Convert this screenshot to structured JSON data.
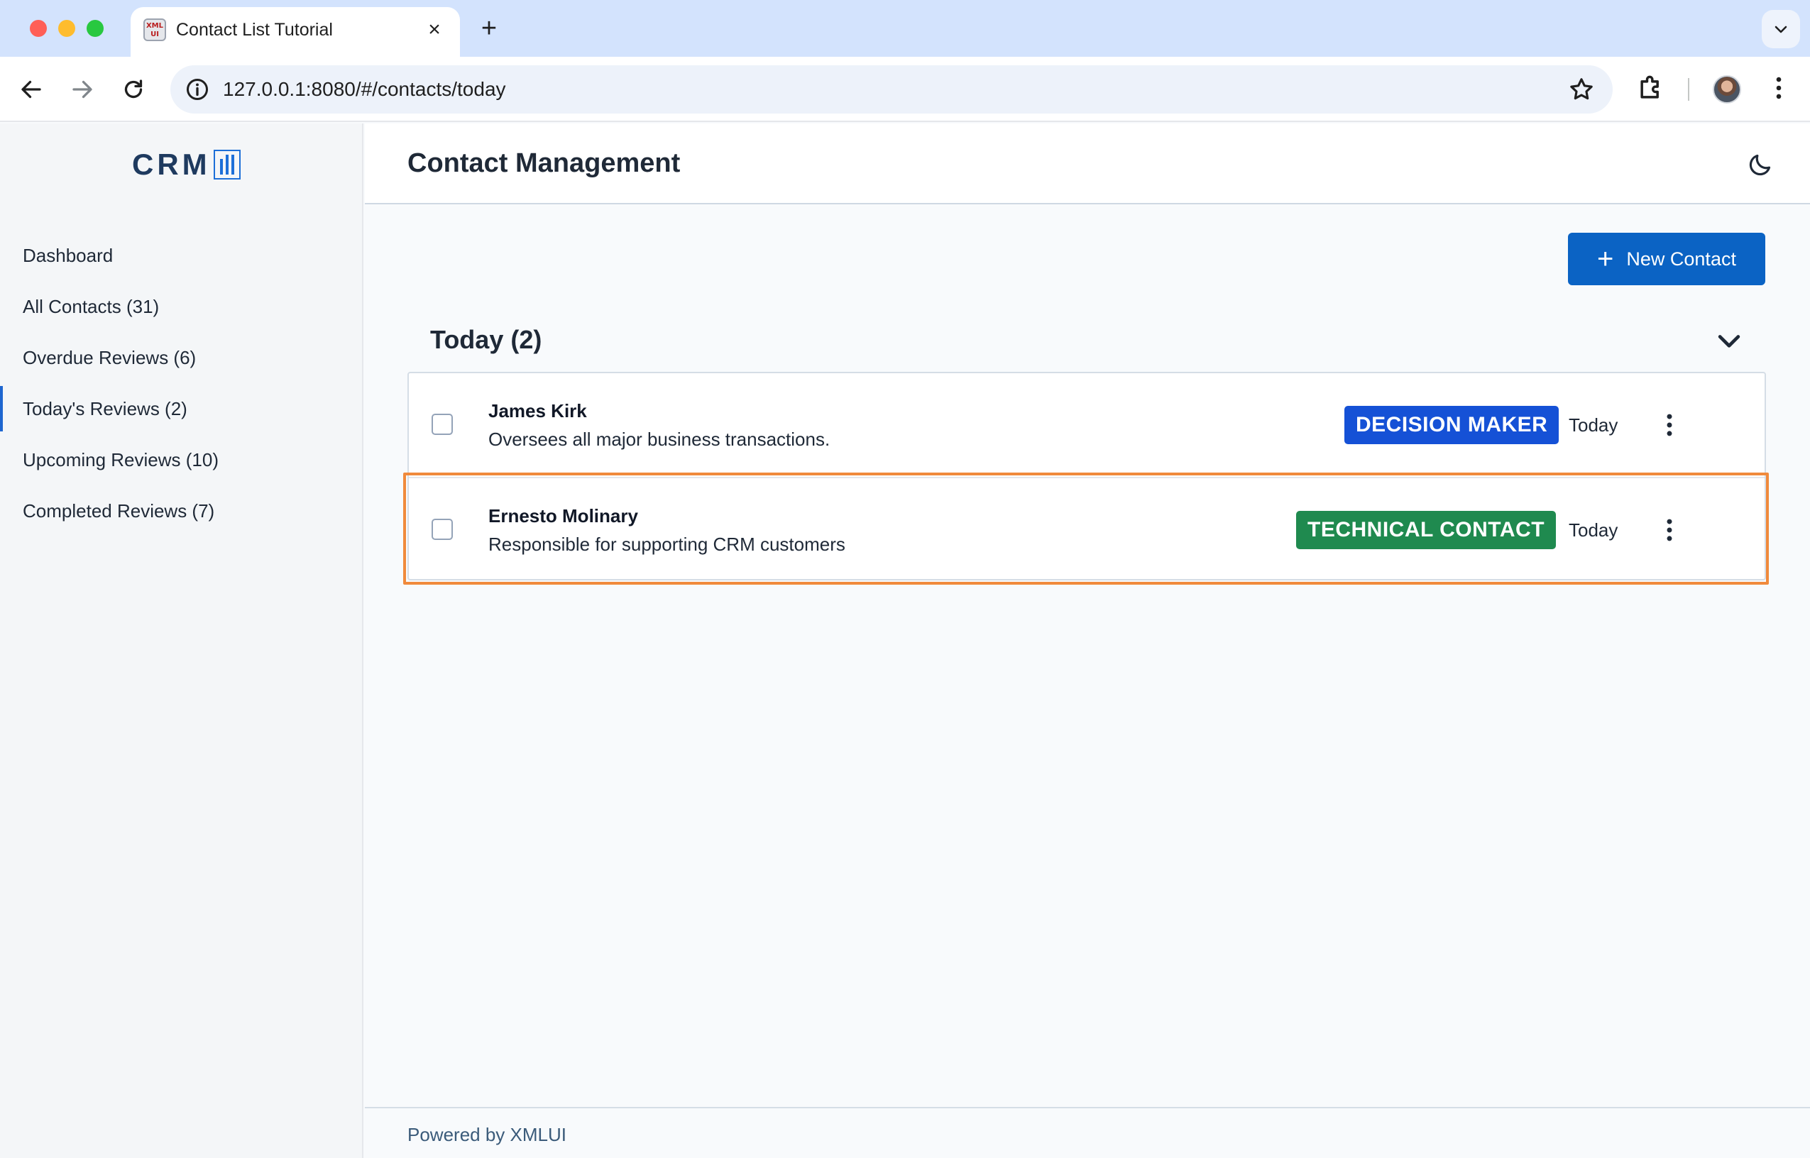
{
  "browser": {
    "tab_title": "Contact List Tutorial",
    "tab_favicon_text": "XML UI",
    "new_tab_symbol": "+",
    "url": "127.0.0.1:8080/#/contacts/today"
  },
  "app": {
    "logo_text": "CRM",
    "header_title": "Contact Management",
    "accent_color": "#0b63c4",
    "sidebar": {
      "items": [
        {
          "label": "Dashboard",
          "active": false
        },
        {
          "label": "All Contacts (31)",
          "active": false
        },
        {
          "label": "Overdue Reviews (6)",
          "active": false
        },
        {
          "label": "Today's Reviews (2)",
          "active": true
        },
        {
          "label": "Upcoming Reviews (10)",
          "active": false
        },
        {
          "label": "Completed Reviews (7)",
          "active": false
        }
      ]
    },
    "main": {
      "new_contact_label": "New Contact",
      "section_title": "Today (2)",
      "contacts": [
        {
          "name": "James Kirk",
          "description": "Oversees all major business transactions.",
          "badge": "DECISION MAKER",
          "badge_color": "#1551d6",
          "date": "Today",
          "checked": false
        },
        {
          "name": "Ernesto Molinary",
          "description": "Responsible for supporting CRM customers",
          "badge": "TECHNICAL CONTACT",
          "badge_color": "#1f8a4f",
          "date": "Today",
          "checked": false
        }
      ],
      "highlight_color": "#f08a3c"
    },
    "footer_text": "Powered by XMLUI"
  },
  "icons": {
    "back": "arrow-left-icon",
    "forward": "arrow-right-icon",
    "reload": "reload-icon",
    "site_info": "info-icon",
    "bookmark": "star-icon",
    "extensions": "puzzle-icon",
    "profile": "avatar",
    "browser_menu": "kebab-icon",
    "theme": "moon-icon",
    "collapse": "chevron-down-icon",
    "row_menu": "kebab-icon"
  }
}
